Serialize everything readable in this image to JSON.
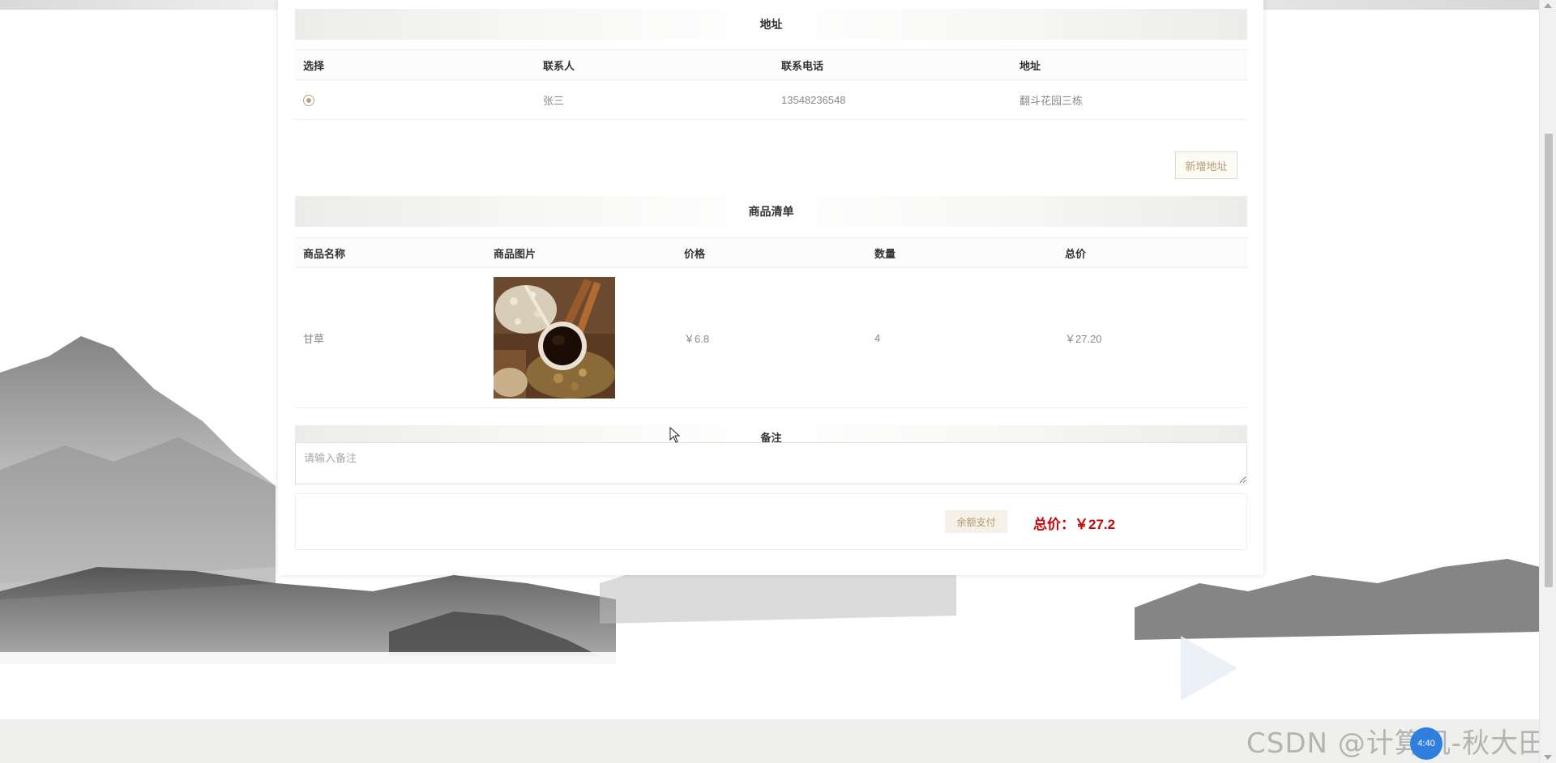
{
  "address_section": {
    "title": "地址",
    "columns": [
      "选择",
      "联系人",
      "联系电话",
      "地址"
    ],
    "rows": [
      {
        "selected": true,
        "contact": "张三",
        "phone": "13548236548",
        "address": "翻斗花园三栋"
      }
    ],
    "add_button_label": "新增地址"
  },
  "goods_section": {
    "title": "商品清单",
    "columns": [
      "商品名称",
      "商品图片",
      "价格",
      "数量",
      "总价"
    ],
    "rows": [
      {
        "name": "甘草",
        "image_icon": "herbal-medicine-photo",
        "price": "￥6.8",
        "quantity": "4",
        "total": "￥27.20"
      }
    ]
  },
  "remark_section": {
    "title": "备注",
    "placeholder": "请输入备注",
    "value": ""
  },
  "payment": {
    "balance_button_label": "余额支付",
    "total_label": "总价：",
    "total_value": "￥27.2"
  },
  "overlay": {
    "watermark": "CSDN @计算机-秋大田",
    "badge_text": "4:40"
  },
  "colors": {
    "accent": "#b59a6a",
    "price_red": "#c0080a",
    "background_footer": "#efefed"
  }
}
